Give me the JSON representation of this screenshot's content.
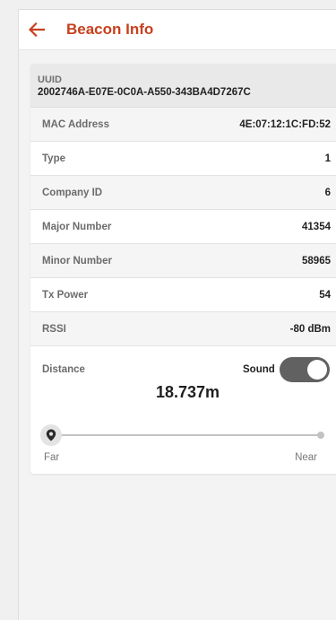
{
  "colors": {
    "accent": "#c8401e",
    "toggle_on": "#616161"
  },
  "header": {
    "title": "Beacon Info",
    "back_icon": "arrow-left-icon"
  },
  "uuid": {
    "label": "UUID",
    "value": "2002746A-E07E-0C0A-A550-343BA4D7267C"
  },
  "rows": [
    {
      "label": "MAC Address",
      "value": "4E:07:12:1C:FD:52"
    },
    {
      "label": "Type",
      "value": "1"
    },
    {
      "label": "Company ID",
      "value": "6"
    },
    {
      "label": "Major Number",
      "value": "41354"
    },
    {
      "label": "Minor Number",
      "value": "58965"
    },
    {
      "label": "Tx Power",
      "value": "54"
    },
    {
      "label": "RSSI",
      "value": "-80 dBm"
    }
  ],
  "distance": {
    "label": "Distance",
    "value": "18.737m",
    "sound_label": "Sound",
    "sound_on": true,
    "slider_position": 0,
    "slider_icon": "location-pin-icon",
    "far_label": "Far",
    "near_label": "Near"
  }
}
